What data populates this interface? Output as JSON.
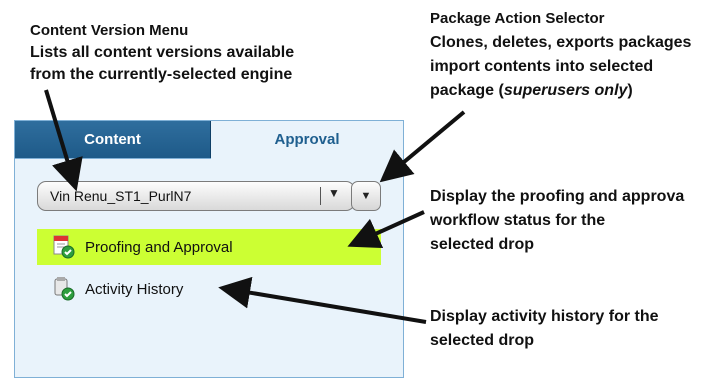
{
  "callouts": {
    "content_version_menu": {
      "title": "Content Version Menu",
      "line1": "Lists all content versions available",
      "line2": "from the currently-selected engine"
    },
    "package_action_selector": {
      "title": "Package Action Selector",
      "line1": "Clones, deletes, exports packages",
      "line2": "import contents into selected",
      "line3_prefix": "package (",
      "line3_em": "superusers only",
      "line3_suffix": ")"
    },
    "proofing": {
      "line1": "Display the proofing and approva",
      "line2": "workflow status for the",
      "line3": "selected drop"
    },
    "activity": {
      "line1": "Display activity history for the",
      "line2": "selected drop"
    }
  },
  "tabs": {
    "content": "Content",
    "approval": "Approval"
  },
  "version_select": {
    "value": "Vin Renu_ST1_PurlN7"
  },
  "menu": {
    "proofing": "Proofing and Approval",
    "activity": "Activity History"
  },
  "colors": {
    "highlight": "#ccff33",
    "tab_active": "#1e5a88",
    "panel_bg": "#e9f3fb"
  },
  "icons": {
    "proofing": "document-check-icon",
    "activity": "history-check-icon"
  }
}
